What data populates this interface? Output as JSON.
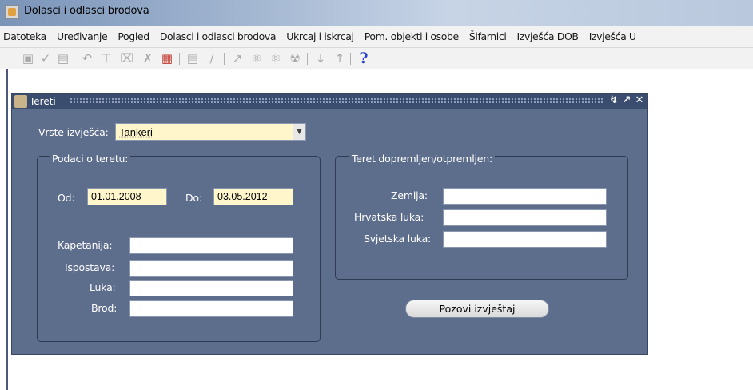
{
  "window": {
    "title": "Dolasci i odlasci brodova"
  },
  "menu": [
    "Datoteka",
    "Uređivanje",
    "Pogled",
    "Dolasci i odlasci brodova",
    "Ukrcaj i iskrcaj",
    "Pom. objekti i osobe",
    "Šifarnici",
    "Izvješća DOB",
    "Izvješća U"
  ],
  "toolbar": {
    "icons": [
      "save-icon",
      "check-icon",
      "print-icon",
      "undo-icon",
      "filter-icon",
      "filter-clear-icon",
      "tool-icon",
      "screen-icon",
      "list-icon",
      "edit-icon",
      "wand-icon",
      "query-icon",
      "query-alt-icon",
      "cancel-query-icon",
      "arrow-down-icon",
      "arrow-up-icon",
      "help-icon"
    ],
    "help_label": "?"
  },
  "form": {
    "title": "Tereti",
    "report_type_label": "Vrste izvješća:",
    "report_type_value": "Tankeri",
    "cargo_group_label": "Podaci o teretu:",
    "from_label": "Od:",
    "from_value": "01.01.2008",
    "to_label": "Do:",
    "to_value": "03.05.2012",
    "harbour_master_label": "Kapetanija:",
    "branch_label": "Ispostava:",
    "port_label": "Luka:",
    "ship_label": "Brod:",
    "delivered_group_label": "Teret dopremljen/otpremljen:",
    "country_label": "Zemlja:",
    "croatian_port_label": "Hrvatska luka:",
    "world_port_label": "Svjetska luka:",
    "submit_label": "Pozovi izvještaj"
  },
  "colors": {
    "window_bg": "#5d6d8c",
    "window_title_bg": "#3a4d6e",
    "field_required": "#fff6cc",
    "help_icon": "#2b3fd0"
  }
}
